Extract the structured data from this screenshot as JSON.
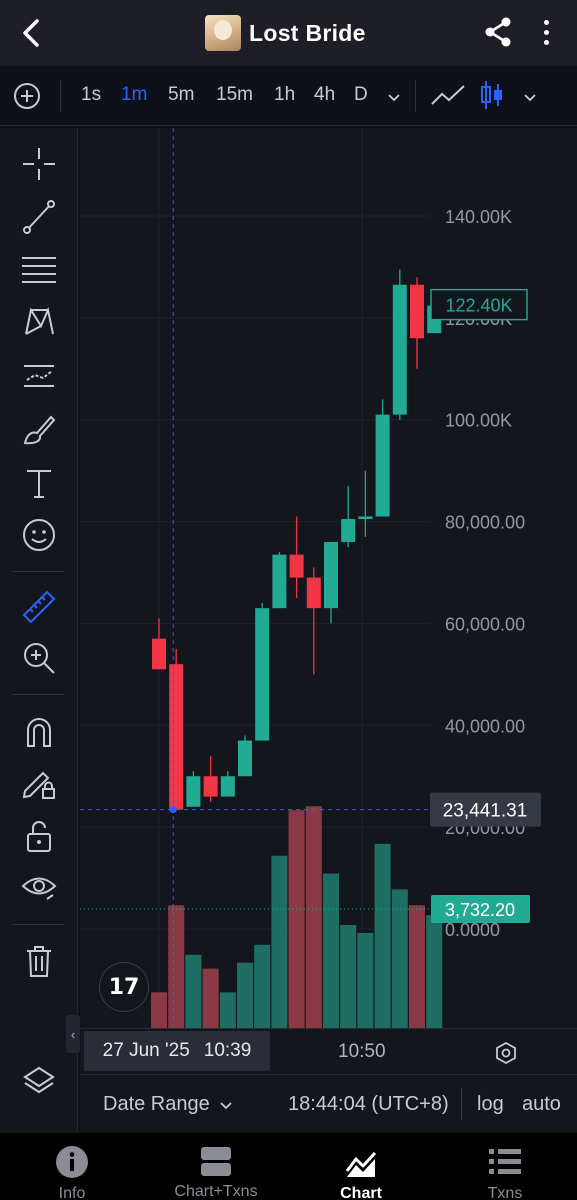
{
  "header": {
    "title": "Lost Bride",
    "back_icon": "chevron-left-icon",
    "share_icon": "share-icon",
    "more_icon": "more-vertical-icon"
  },
  "toolbar": {
    "add_icon": "plus-circle-icon",
    "intervals": [
      "1s",
      "1m",
      "5m",
      "15m",
      "1h",
      "4h",
      "D"
    ],
    "active_interval": "1m",
    "accent_color": "#2962ff"
  },
  "tools": [
    "crosshair-icon",
    "trend-line-icon",
    "fib-lines-icon",
    "pattern-icon",
    "forecast-icon",
    "brush-icon",
    "text-icon",
    "emoji-icon",
    "ruler-icon",
    "zoom-in-icon",
    "magnet-icon",
    "lock-drawing-icon",
    "unlock-icon",
    "eye-icon",
    "trash-icon",
    "layers-icon"
  ],
  "chart_data": {
    "type": "candlestick",
    "interval": "1m",
    "price_axis": [
      "140.00K",
      "120.00K",
      "100.00K",
      "80,000.00",
      "60,000.00",
      "40,000.00",
      "20,000.00",
      "0.0000"
    ],
    "ylim": [
      0,
      145000
    ],
    "up_color": "#22ab94",
    "down_color": "#f23645",
    "candles": [
      {
        "open": 57000,
        "high": 61000,
        "low": 51000,
        "close": 51000
      },
      {
        "open": 52000,
        "high": 55000,
        "low": 23441,
        "close": 23441
      },
      {
        "open": 24000,
        "high": 31000,
        "low": 24000,
        "close": 30000
      },
      {
        "open": 30000,
        "high": 34000,
        "low": 25000,
        "close": 26000
      },
      {
        "open": 26000,
        "high": 31000,
        "low": 26000,
        "close": 30000
      },
      {
        "open": 30000,
        "high": 38000,
        "low": 30000,
        "close": 37000
      },
      {
        "open": 37000,
        "high": 64000,
        "low": 37000,
        "close": 63000
      },
      {
        "open": 63000,
        "high": 74000,
        "low": 63000,
        "close": 73500
      },
      {
        "open": 73500,
        "high": 81000,
        "low": 65000,
        "close": 69000
      },
      {
        "open": 69000,
        "high": 71000,
        "low": 50000,
        "close": 63000
      },
      {
        "open": 63000,
        "high": 76000,
        "low": 60000,
        "close": 76000
      },
      {
        "open": 76000,
        "high": 87000,
        "low": 75000,
        "close": 80500
      },
      {
        "open": 80500,
        "high": 90000,
        "low": 77000,
        "close": 81000
      },
      {
        "open": 81000,
        "high": 104000,
        "low": 81000,
        "close": 101000
      },
      {
        "open": 101000,
        "high": 129500,
        "low": 100000,
        "close": 126500
      },
      {
        "open": 126500,
        "high": 128000,
        "low": 110000,
        "close": 116000
      },
      {
        "open": 117000,
        "high": 123000,
        "low": 117000,
        "close": 122400
      }
    ],
    "volume": [
      {
        "value": 0.18,
        "dir": "down"
      },
      {
        "value": 0.62,
        "dir": "down"
      },
      {
        "value": 0.37,
        "dir": "up"
      },
      {
        "value": 0.3,
        "dir": "down"
      },
      {
        "value": 0.18,
        "dir": "up"
      },
      {
        "value": 0.33,
        "dir": "up"
      },
      {
        "value": 0.42,
        "dir": "up"
      },
      {
        "value": 0.87,
        "dir": "up"
      },
      {
        "value": 1.1,
        "dir": "down"
      },
      {
        "value": 1.12,
        "dir": "down"
      },
      {
        "value": 0.78,
        "dir": "up"
      },
      {
        "value": 0.52,
        "dir": "up"
      },
      {
        "value": 0.48,
        "dir": "up"
      },
      {
        "value": 0.93,
        "dir": "up"
      },
      {
        "value": 0.7,
        "dir": "up"
      },
      {
        "value": 0.62,
        "dir": "down"
      },
      {
        "value": 0.57,
        "dir": "up"
      }
    ],
    "crosshair": {
      "price_label": "23,441.31",
      "time_label_date": "27 Jun '25",
      "time_label_time": "10:39"
    },
    "last_price_label": "122.40K",
    "volume_label": "3,732.20",
    "time_ticks": [
      "10:50"
    ],
    "watermark_icon": "tradingview-logo-icon",
    "scroll_right_icon": "double-chevron-right-icon",
    "grid": true
  },
  "status": {
    "date_range": "Date Range",
    "clock": "18:44:04 (UTC+8)",
    "log": "log",
    "auto": "auto"
  },
  "nav": [
    {
      "label": "Info",
      "icon": "info-icon"
    },
    {
      "label": "Chart+Txns",
      "icon": "chart-txns-icon"
    },
    {
      "label": "Chart",
      "icon": "chart-icon"
    },
    {
      "label": "Txns",
      "icon": "list-icon"
    }
  ],
  "nav_active": "Chart"
}
